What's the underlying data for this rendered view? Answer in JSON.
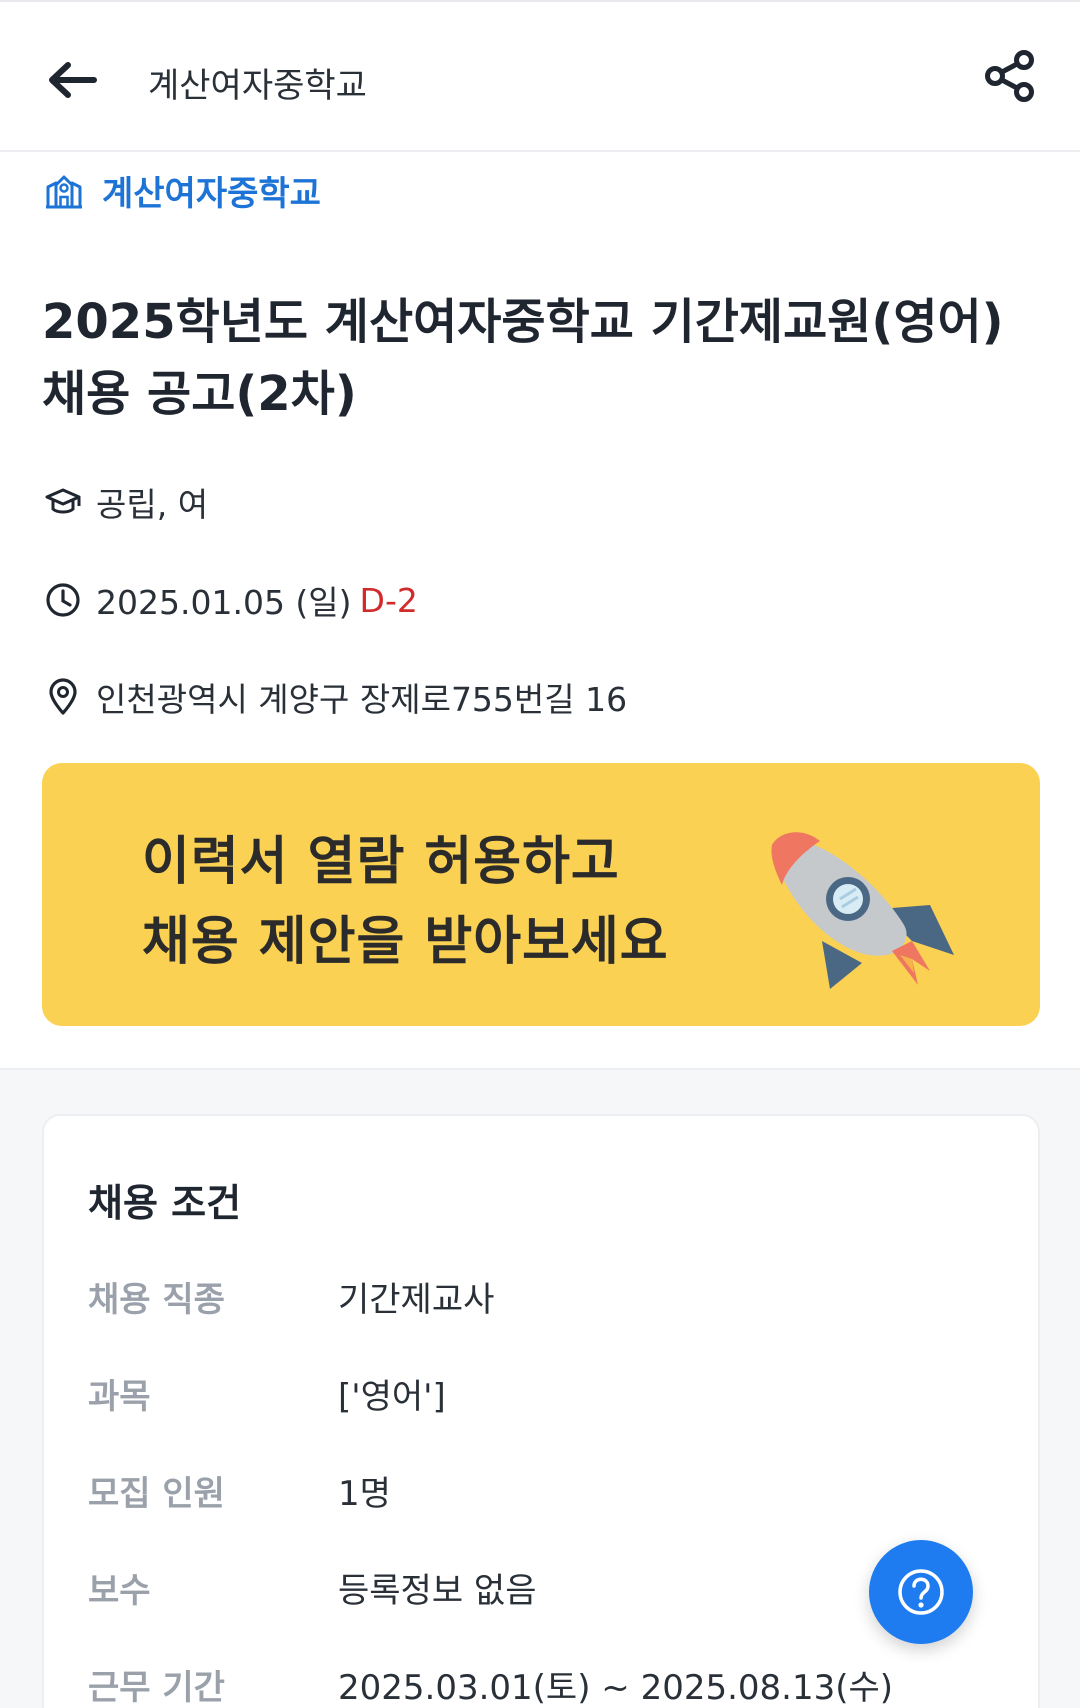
{
  "header": {
    "title": "계산여자중학교",
    "back_icon": "arrow-left-icon",
    "share_icon": "share-icon"
  },
  "school_link": {
    "name": "계산여자중학교",
    "icon": "school-building-icon",
    "color": "#1d74d6"
  },
  "post": {
    "title": "2025학년도 계산여자중학교 기간제교원(영어) 채용 공고(2차)",
    "school_type": "공립, 여",
    "deadline": "2025.01.05 (일)",
    "dday": "D-2",
    "address": "인천광역시 계양구 장제로755번길 16"
  },
  "banner": {
    "line1": "이력서 열람 허용하고",
    "line2": "채용 제안을 받아보세요",
    "bg_color": "#fad152",
    "icon": "rocket-icon"
  },
  "conditions": {
    "title": "채용 조건",
    "rows": [
      {
        "label": "채용 직종",
        "value": "기간제교사"
      },
      {
        "label": "과목",
        "value": "['영어']"
      },
      {
        "label": "모집 인원",
        "value": "1명"
      },
      {
        "label": "보수",
        "value": "등록정보 없음"
      },
      {
        "label": "근무 기간",
        "value": "2025.03.01(토) ~ 2025.08.13(수)"
      }
    ]
  },
  "fab": {
    "icon": "help-question-icon",
    "color": "#1e7cf0"
  }
}
